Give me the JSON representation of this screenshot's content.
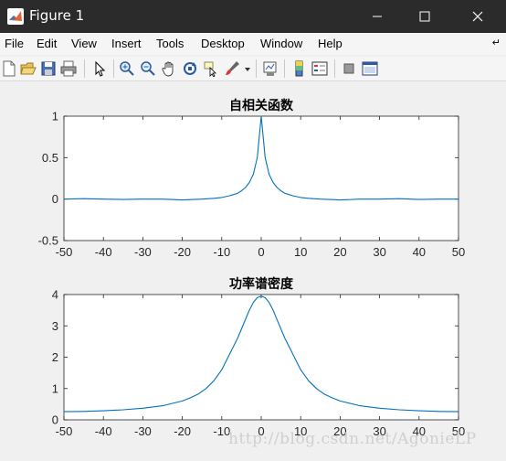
{
  "window": {
    "title": "Figure 1"
  },
  "menu": {
    "items": [
      "File",
      "Edit",
      "View",
      "Insert",
      "Tools",
      "Desktop",
      "Window",
      "Help"
    ],
    "overflow_icon": "dock-arrow-icon"
  },
  "toolbar": {
    "icons": [
      "new-figure-icon",
      "open-file-icon",
      "save-icon",
      "print-icon",
      "pointer-icon",
      "zoom-in-icon",
      "zoom-out-icon",
      "pan-hand-icon",
      "rotate-3d-icon",
      "data-cursor-icon",
      "brush-icon",
      "brush-dropdown-icon",
      "link-plot-icon",
      "colorbar-icon",
      "legend-icon",
      "hide-plot-tools-icon",
      "show-plot-tools-icon"
    ]
  },
  "chart_data": [
    {
      "type": "line",
      "title": "自相关函数",
      "xlabel": "",
      "ylabel": "",
      "xlim": [
        -50,
        50
      ],
      "ylim": [
        -0.5,
        1
      ],
      "xticks": [
        -50,
        -40,
        -30,
        -20,
        -10,
        0,
        10,
        20,
        30,
        40,
        50
      ],
      "yticks": [
        -0.5,
        0,
        0.5,
        1
      ],
      "color": "#0072bd",
      "x": [
        -50,
        -45,
        -40,
        -35,
        -30,
        -25,
        -20,
        -15,
        -12,
        -10,
        -8,
        -6,
        -5,
        -4,
        -3,
        -2,
        -1,
        0,
        1,
        2,
        3,
        4,
        5,
        6,
        8,
        10,
        12,
        15,
        20,
        25,
        30,
        35,
        40,
        45,
        50
      ],
      "y": [
        0.0,
        0.005,
        0.0,
        -0.005,
        0.0,
        0.0,
        -0.01,
        0.0,
        0.01,
        0.02,
        0.04,
        0.07,
        0.1,
        0.14,
        0.2,
        0.3,
        0.5,
        1.0,
        0.5,
        0.3,
        0.2,
        0.14,
        0.1,
        0.07,
        0.04,
        0.02,
        0.01,
        0.0,
        -0.01,
        0.0,
        0.0,
        0.005,
        -0.005,
        0.0,
        0.0
      ]
    },
    {
      "type": "line",
      "title": "功率谱密度",
      "xlabel": "",
      "ylabel": "",
      "xlim": [
        -50,
        50
      ],
      "ylim": [
        0,
        4
      ],
      "xticks": [
        -50,
        -40,
        -30,
        -20,
        -10,
        0,
        10,
        20,
        30,
        40,
        50
      ],
      "yticks": [
        0,
        1,
        2,
        3,
        4
      ],
      "color": "#0072bd",
      "x": [
        -50,
        -45,
        -40,
        -35,
        -30,
        -25,
        -20,
        -18,
        -16,
        -14,
        -12,
        -10,
        -8,
        -6,
        -4,
        -3,
        -2,
        -1,
        0,
        1,
        2,
        3,
        4,
        6,
        8,
        10,
        12,
        14,
        16,
        18,
        20,
        25,
        30,
        35,
        40,
        45,
        50
      ],
      "y": [
        0.26,
        0.27,
        0.29,
        0.32,
        0.37,
        0.45,
        0.6,
        0.7,
        0.82,
        1.0,
        1.25,
        1.6,
        2.1,
        2.6,
        3.2,
        3.5,
        3.75,
        3.9,
        3.95,
        3.9,
        3.75,
        3.5,
        3.2,
        2.6,
        2.1,
        1.6,
        1.25,
        1.0,
        0.82,
        0.7,
        0.6,
        0.45,
        0.37,
        0.32,
        0.29,
        0.27,
        0.26
      ]
    }
  ],
  "watermark": "http://blog.csdn.net/AgonieLP"
}
